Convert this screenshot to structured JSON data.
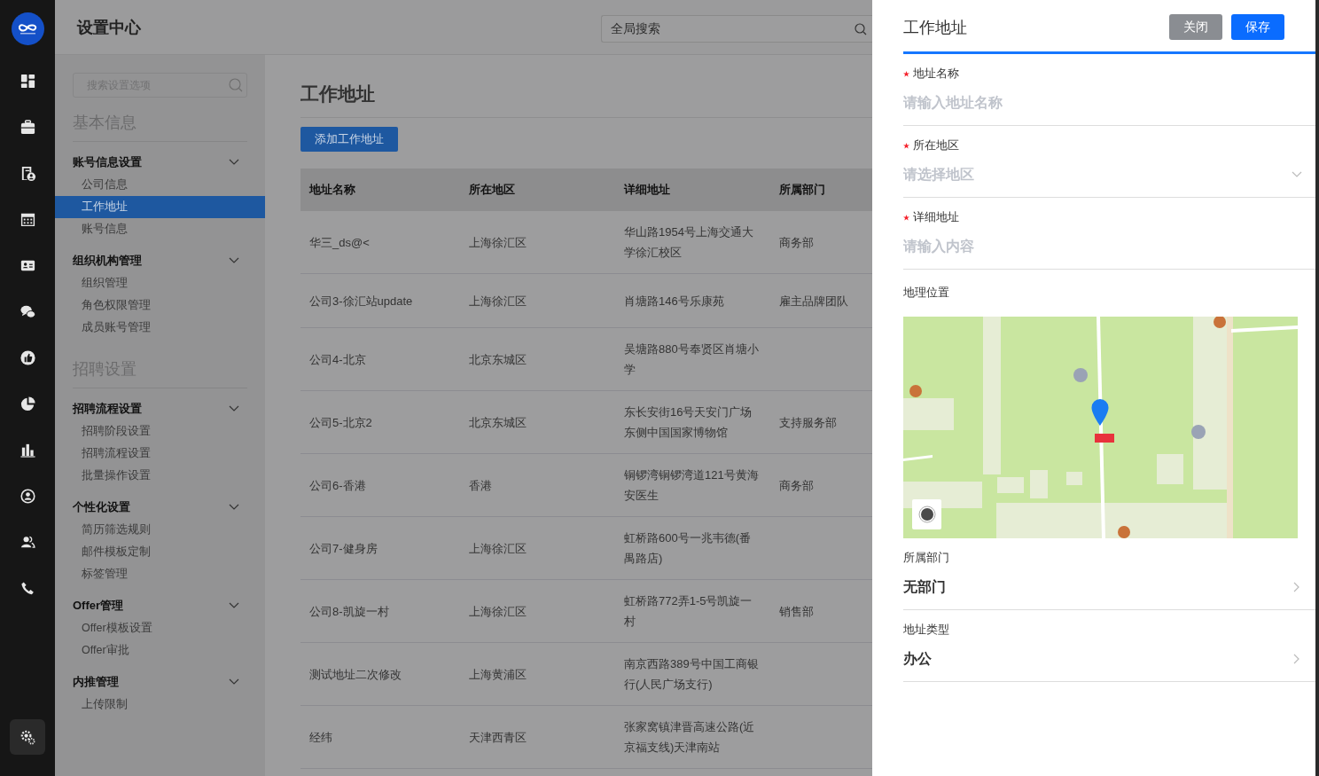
{
  "rail": {
    "items": [
      {
        "selected": false
      },
      {
        "selected": false
      },
      {
        "selected": false
      },
      {
        "selected": false
      },
      {
        "selected": false
      },
      {
        "selected": false
      },
      {
        "selected": false
      },
      {
        "selected": false
      },
      {
        "selected": false
      },
      {
        "selected": false
      },
      {
        "selected": false
      },
      {
        "selected": false
      },
      {
        "selected": true
      }
    ]
  },
  "header": {
    "title": "设置中心",
    "search_placeholder": "全局搜索"
  },
  "settings_nav": {
    "search_placeholder": "搜索设置选项",
    "sections": [
      {
        "title": "基本信息",
        "groups": [
          {
            "title": "账号信息设置",
            "expanded": true,
            "items": [
              {
                "label": "公司信息",
                "selected": false
              },
              {
                "label": "工作地址",
                "selected": true
              },
              {
                "label": "账号信息",
                "selected": false
              }
            ]
          },
          {
            "title": "组织机构管理",
            "expanded": true,
            "items": [
              {
                "label": "组织管理",
                "selected": false
              },
              {
                "label": "角色权限管理",
                "selected": false
              },
              {
                "label": "成员账号管理",
                "selected": false
              }
            ]
          }
        ]
      },
      {
        "title": "招聘设置",
        "groups": [
          {
            "title": "招聘流程设置",
            "expanded": true,
            "items": [
              {
                "label": "招聘阶段设置",
                "selected": false
              },
              {
                "label": "招聘流程设置",
                "selected": false
              },
              {
                "label": "批量操作设置",
                "selected": false
              }
            ]
          },
          {
            "title": "个性化设置",
            "expanded": true,
            "items": [
              {
                "label": "简历筛选规则",
                "selected": false
              },
              {
                "label": "邮件模板定制",
                "selected": false
              },
              {
                "label": "标签管理",
                "selected": false
              }
            ]
          },
          {
            "title": "Offer管理",
            "expanded": true,
            "items": [
              {
                "label": "Offer模板设置",
                "selected": false
              },
              {
                "label": "Offer审批",
                "selected": false
              }
            ]
          },
          {
            "title": "内推管理",
            "expanded": true,
            "items": [
              {
                "label": "上传限制",
                "selected": false
              }
            ]
          }
        ]
      }
    ]
  },
  "main": {
    "title": "工作地址",
    "add_button": "添加工作地址",
    "table": {
      "columns": [
        "地址名称",
        "所在地区",
        "详细地址",
        "所属部门"
      ],
      "rows": [
        [
          "华三_ds@<",
          "上海徐汇区",
          "华山路1954号上海交通大学徐汇校区",
          "商务部"
        ],
        [
          "公司3-徐汇站update",
          "上海徐汇区",
          "肖塘路146号乐康苑",
          "雇主品牌团队"
        ],
        [
          "公司4-北京",
          "北京东城区",
          "吴塘路880号奉贤区肖塘小学",
          ""
        ],
        [
          "公司5-北京2",
          "北京东城区",
          "东长安街16号天安门广场东侧中国国家博物馆",
          "支持服务部"
        ],
        [
          "公司6-香港",
          "香港",
          "铜锣湾铜锣湾道121号黄海安医生",
          "商务部"
        ],
        [
          "公司7-健身房",
          "上海徐汇区",
          "虹桥路600号一兆韦德(番禺路店)",
          ""
        ],
        [
          "公司8-凯旋一村",
          "上海徐汇区",
          "虹桥路772弄1-5号凯旋一村",
          "销售部"
        ],
        [
          "测试地址二次修改",
          "上海黄浦区",
          "南京西路389号中国工商银行(人民广场支行)",
          ""
        ],
        [
          "经纬",
          "天津西青区",
          "张家窝镇津晋高速公路(近京福支线)天津南站",
          ""
        ]
      ]
    }
  },
  "drawer": {
    "title": "工作地址",
    "buttons": [
      {
        "label": "关闭",
        "kind": "secondary"
      },
      {
        "label": "保存",
        "kind": "primary"
      }
    ],
    "fields": [
      {
        "label": "地址名称",
        "required": true,
        "kind": "input",
        "placeholder": "请输入地址名称"
      },
      {
        "label": "所在地区",
        "required": true,
        "kind": "select",
        "placeholder": "请选择地区"
      },
      {
        "label": "详细地址",
        "required": true,
        "kind": "input",
        "placeholder": "请输入内容"
      },
      {
        "label": "地理位置",
        "required": false,
        "kind": "map"
      },
      {
        "label": "所属部门",
        "required": false,
        "kind": "link",
        "value": "无部门"
      },
      {
        "label": "地址类型",
        "required": false,
        "kind": "link",
        "value": "办公"
      }
    ]
  }
}
